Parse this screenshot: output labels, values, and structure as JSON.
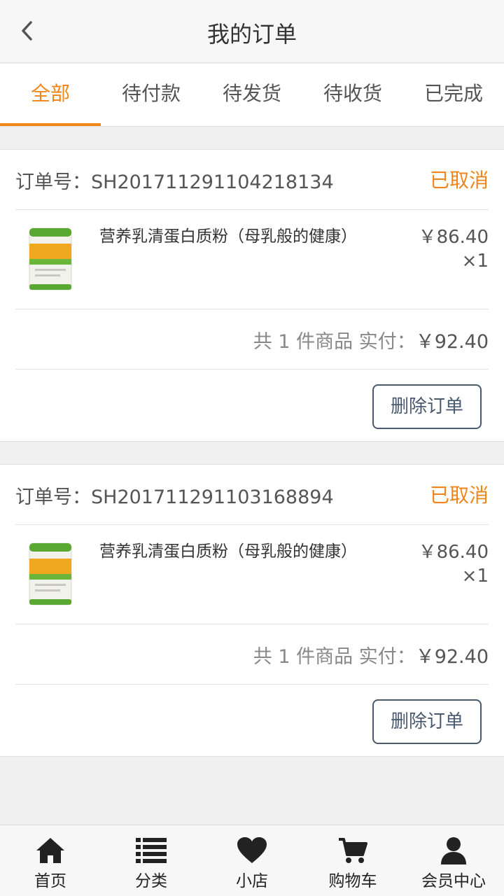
{
  "header": {
    "title": "我的订单"
  },
  "tabs": [
    {
      "label": "全部",
      "active": true
    },
    {
      "label": "待付款",
      "active": false
    },
    {
      "label": "待发货",
      "active": false
    },
    {
      "label": "待收货",
      "active": false
    },
    {
      "label": "已完成",
      "active": false
    }
  ],
  "orders": [
    {
      "order_no": "订单号：SH201711291104218134",
      "status": "已取消",
      "item": {
        "name": "营养乳清蛋白质粉（母乳般的健康）",
        "price": "￥86.40",
        "qty": "×1"
      },
      "summary_prefix": "共 1 件商品 实付：",
      "summary_amount": "￥92.40",
      "delete_label": "删除订单"
    },
    {
      "order_no": "订单号：SH201711291103168894",
      "status": "已取消",
      "item": {
        "name": "营养乳清蛋白质粉（母乳般的健康）",
        "price": "￥86.40",
        "qty": "×1"
      },
      "summary_prefix": "共 1 件商品 实付：",
      "summary_amount": "￥92.40",
      "delete_label": "删除订单"
    }
  ],
  "bottom_nav": [
    {
      "label": "首页",
      "icon": "home-icon"
    },
    {
      "label": "分类",
      "icon": "list-icon"
    },
    {
      "label": "小店",
      "icon": "heart-icon"
    },
    {
      "label": "购物车",
      "icon": "cart-icon"
    },
    {
      "label": "会员中心",
      "icon": "user-icon"
    }
  ],
  "colors": {
    "accent": "#f08519",
    "button_border": "#4a5a6e",
    "background": "#f0f0f0"
  }
}
